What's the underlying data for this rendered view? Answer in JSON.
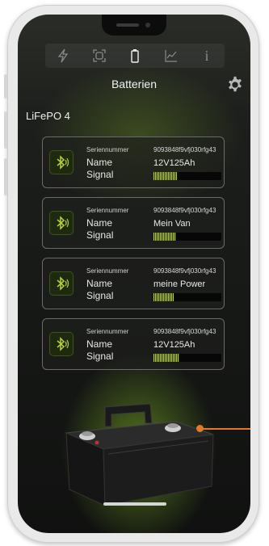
{
  "header": {
    "title": "Batterien"
  },
  "tabs": [
    {
      "icon": "lightning-icon"
    },
    {
      "icon": "scan-icon"
    },
    {
      "icon": "battery-icon",
      "active": true
    },
    {
      "icon": "chart-icon"
    },
    {
      "icon": "info-icon",
      "label": "i"
    }
  ],
  "group_label": "LiFePO 4",
  "labels": {
    "serial": "Seriennummer",
    "name": "Name",
    "signal": "Signal"
  },
  "batteries": [
    {
      "serial": "9093848f9vfj030rfg43",
      "name": "12V125Ah",
      "signal_percent": 35
    },
    {
      "serial": "9093848f9vfj030rfg43",
      "name": "Mein Van",
      "signal_percent": 33
    },
    {
      "serial": "9093848f9vfj030rfg43",
      "name": "meine Power",
      "signal_percent": 30
    },
    {
      "serial": "9093848f9vfj030rfg43",
      "name": "12V125Ah",
      "signal_percent": 38
    }
  ],
  "colors": {
    "accent": "#b9d23a",
    "callout": "#e07a2a"
  }
}
